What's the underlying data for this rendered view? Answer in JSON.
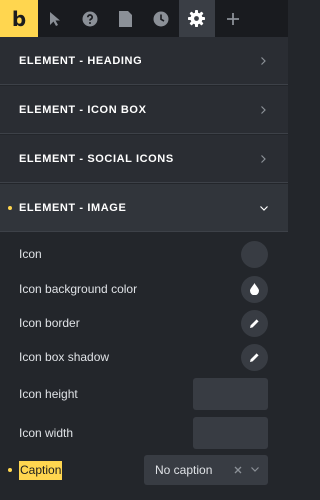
{
  "toolbar": {
    "logo": "b",
    "icons": [
      "pointer-icon",
      "help-icon",
      "document-icon",
      "history-icon",
      "settings-icon",
      "plus-icon"
    ],
    "active": "settings-icon"
  },
  "accordion": [
    {
      "title": "ELEMENT - HEADING",
      "open": false
    },
    {
      "title": "ELEMENT - ICON BOX",
      "open": false
    },
    {
      "title": "ELEMENT - SOCIAL ICONS",
      "open": false
    },
    {
      "title": "ELEMENT - IMAGE",
      "open": true
    }
  ],
  "image_settings": {
    "icon": "Icon",
    "icon_background_color": "Icon background color",
    "icon_border": "Icon border",
    "icon_box_shadow": "Icon box shadow",
    "icon_height": "Icon height",
    "icon_width": "Icon width",
    "caption": {
      "label": "Caption",
      "value": "No caption"
    }
  },
  "colors": {
    "accent": "#ffd64f",
    "background": "#23262b",
    "toolbar": "#191b1f",
    "control": "#383c43"
  }
}
